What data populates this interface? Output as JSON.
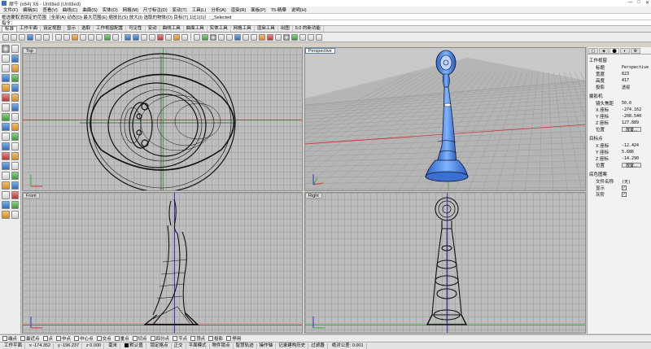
{
  "window": {
    "title": "犀牛 (x64) X6 - Untitled (Untitled)",
    "controls": [
      "—",
      "□",
      "✕"
    ]
  },
  "menu": [
    "文件(F)",
    "编辑(E)",
    "查看(V)",
    "曲线(C)",
    "曲面(S)",
    "实体(O)",
    "网格(M)",
    "尺寸标注(D)",
    "变动(T)",
    "工具(L)",
    "分析(A)",
    "渲染(R)",
    "面板(P)",
    "T5-精華",
    "说明(H)"
  ],
  "command_history": "框选要取消锁定的范围（全部(A) 动态(D) 最大范围(E) 缩放比(S) 放大(I) 选取的物体(O) 目标(T) 1比1(1)）: _Selected",
  "command_prompt": "指令：",
  "tabs": [
    {
      "label": "标准",
      "active": true
    },
    {
      "label": "工作平面"
    },
    {
      "label": "设定视图"
    },
    {
      "label": "显示"
    },
    {
      "label": "选取"
    },
    {
      "label": "工作视窗配置"
    },
    {
      "label": "可见性"
    },
    {
      "label": "变动"
    },
    {
      "label": "曲线工具"
    },
    {
      "label": "曲面工具"
    },
    {
      "label": "实体工具"
    },
    {
      "label": "网格工具"
    },
    {
      "label": "渲染工具"
    },
    {
      "label": "出图"
    },
    {
      "label": "5.0 的新功能"
    }
  ],
  "viewports": {
    "top": "Top",
    "perspective": "Perspective",
    "front": "Front",
    "right": "Right"
  },
  "properties": {
    "tabs": [
      "▢",
      "◈",
      "⬤",
      "◐",
      "⚙"
    ],
    "section_view": "工作视窗",
    "rows_view": [
      {
        "k": "标题",
        "v": "Perspective"
      },
      {
        "k": "宽度",
        "v": "823"
      },
      {
        "k": "高度",
        "v": "417"
      },
      {
        "k": "投影",
        "v": "透视"
      }
    ],
    "section_camera": "摄影机",
    "rows_camera": [
      {
        "k": "镜头焦距",
        "v": "50.0"
      },
      {
        "k": "X 座标",
        "v": "-274.162"
      },
      {
        "k": "Y 座标",
        "v": "-208.540"
      },
      {
        "k": "Z 座标",
        "v": "127.889"
      }
    ],
    "position_label": "位置",
    "place_button": "放置...",
    "section_target": "目标点",
    "rows_target": [
      {
        "k": "X 座标",
        "v": "-12.424"
      },
      {
        "k": "Y 座标",
        "v": "5.686"
      },
      {
        "k": "Z 座标",
        "v": "-14.290"
      }
    ],
    "section_wallpaper": "底色图案",
    "rows_wallpaper": [
      {
        "k": "文件名称",
        "v": "(无)"
      },
      {
        "k": "显示",
        "v": "✓"
      },
      {
        "k": "灰阶",
        "v": "✓"
      }
    ]
  },
  "osnap": [
    "端点",
    "最近点",
    "点",
    "中点",
    "中心点",
    "交点",
    "垂点",
    "切点",
    "四分点",
    "节点",
    "顶点",
    "投影",
    "停用"
  ],
  "status": {
    "cplane": "工作平面",
    "x": "x -174.352",
    "y": "y -196.237",
    "z": "z 0.000",
    "units": "毫米",
    "layer": "默认值",
    "items": [
      "锁定格点",
      "正交",
      "平面模式",
      "物件锁点",
      "智慧轨迹",
      "操作轴",
      "记录建构历史",
      "过滤器"
    ],
    "memory": "绝对公差: 0.001"
  },
  "colors": {
    "model_blue": "#4f8ee8",
    "viewport_bg": "#bdbdbd",
    "grid": "#a9a9a9"
  }
}
